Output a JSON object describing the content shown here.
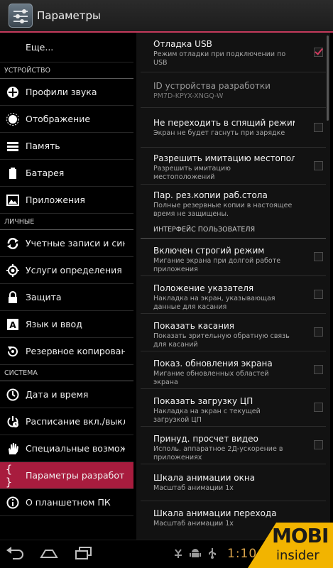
{
  "actionbar": {
    "title": "Параметры",
    "icon": "settings-sliders-icon"
  },
  "accent_color": "#c43a5c",
  "left": {
    "top_item": "Еще...",
    "sections": [
      {
        "header": "УСТРОЙСТВО",
        "items": [
          {
            "label": "Профили звука",
            "icon": "sound-profile-icon"
          },
          {
            "label": "Отображение",
            "icon": "display-brightness-icon"
          },
          {
            "label": "Память",
            "icon": "storage-icon"
          },
          {
            "label": "Батарея",
            "icon": "battery-icon"
          },
          {
            "label": "Приложения",
            "icon": "apps-icon"
          }
        ]
      },
      {
        "header": "ЛИЧНЫЕ",
        "items": [
          {
            "label": "Учетные записи и синхр",
            "icon": "sync-icon"
          },
          {
            "label": "Услуги определения ме",
            "icon": "location-icon"
          },
          {
            "label": "Защита",
            "icon": "lock-icon"
          },
          {
            "label": "Язык и ввод",
            "icon": "keyboard-language-icon"
          },
          {
            "label": "Резервное копирование",
            "icon": "backup-icon"
          }
        ]
      },
      {
        "header": "СИСТЕМА",
        "items": [
          {
            "label": "Дата и время",
            "icon": "clock-icon"
          },
          {
            "label": "Расписание вкл./выкл.",
            "icon": "power-schedule-icon"
          },
          {
            "label": "Специальные возможн",
            "icon": "hand-accessibility-icon"
          },
          {
            "label": "Параметры разработчи",
            "icon": "developer-braces-icon",
            "active": true
          },
          {
            "label": "О планшетном ПК",
            "icon": "info-icon"
          }
        ]
      }
    ]
  },
  "right": {
    "items": [
      {
        "title": "Отладка USB",
        "summary": "Режим отладки при подключении по USB",
        "checkbox": true,
        "checked": true
      },
      {
        "title": "ID устройства разработки",
        "summary": "PM7D-KPYX-XNGQ-W",
        "checkbox": false,
        "dim": true
      },
      {
        "title": "Не переходить в спящий режим",
        "summary": "Экран не будет гаснуть при зарядке",
        "checkbox": true,
        "checked": false
      },
      {
        "title": "Разрешить имитацию местоположений",
        "summary": "Разрешить имитацию местоположений",
        "checkbox": true,
        "checked": false
      },
      {
        "title": "Пар. рез.копии раб.стола",
        "summary": "Полные резервные копии в настоящее время не защищены.",
        "checkbox": false
      }
    ],
    "header": "ИНТЕРФЕЙС ПОЛЬЗОВАТЕЛЯ",
    "items2": [
      {
        "title": "Включен строгий режим",
        "summary": "Мигание экрана при долгой работе приложения",
        "checkbox": true,
        "checked": false
      },
      {
        "title": "Положение указателя",
        "summary": "Накладка на экран, указывающая данные для касания",
        "checkbox": true,
        "checked": false
      },
      {
        "title": "Показать касания",
        "summary": "Показать зрительную обратную связь для касаний",
        "checkbox": true,
        "checked": false
      },
      {
        "title": "Показ. обновления экрана",
        "summary": "Мигание обновленных областей экрана",
        "checkbox": true,
        "checked": false
      },
      {
        "title": "Показать загрузку ЦП",
        "summary": "Накладка на экран с текущей загрузкой ЦП",
        "checkbox": true,
        "checked": false
      },
      {
        "title": "Принуд. просчет видео",
        "summary": "Исполь. аппаратное 2Д-ускорение в приложениях",
        "checkbox": true,
        "checked": false
      },
      {
        "title": "Шкала анимации окна",
        "summary": "Масштаб анимации 1x",
        "checkbox": false
      },
      {
        "title": "Шкала анимации перехода",
        "summary": "Масштаб анимации 1x",
        "checkbox": false
      }
    ]
  },
  "navbar": {
    "clock": "1:10",
    "buttons": [
      "back-icon",
      "home-icon",
      "recent-apps-icon"
    ],
    "status_icons": [
      "usb-debug-icon",
      "android-icon",
      "usb-icon"
    ]
  },
  "watermark": {
    "line1": "MOBI",
    "line2": "insider"
  }
}
